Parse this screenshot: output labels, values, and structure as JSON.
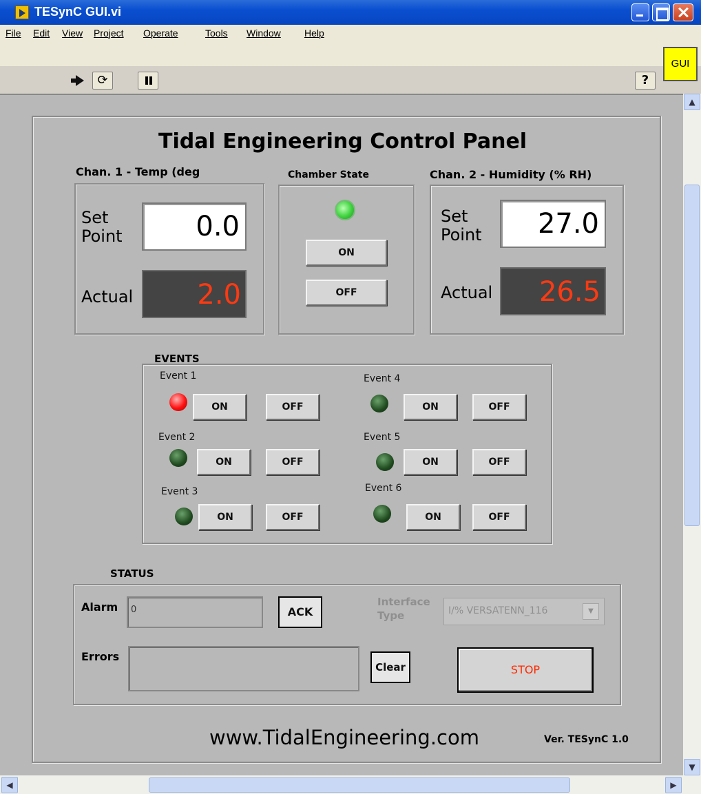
{
  "window": {
    "title": "TESynC GUI.vi"
  },
  "menu": [
    "File",
    "Edit",
    "View",
    "Project",
    "Operate",
    "Tools",
    "Window",
    "Help"
  ],
  "toolbar": {
    "continuous_glyph": "⟳",
    "help_glyph": "?",
    "gui_badge": "GUI"
  },
  "panel": {
    "title": "Tidal Engineering Control Panel",
    "ch1": {
      "label": "Chan. 1 - Temp (deg",
      "set_label": "Set Point",
      "set_value": "0.0",
      "actual_label": "Actual",
      "actual_value": "2.0"
    },
    "chamber": {
      "label": "Chamber State",
      "on_label": "ON",
      "off_label": "OFF",
      "led_state": "on"
    },
    "ch2": {
      "label": "Chan. 2 - Humidity (% RH)",
      "set_label": "Set Point",
      "set_value": "27.0",
      "actual_label": "Actual",
      "actual_value": "26.5"
    },
    "events": {
      "label": "EVENTS",
      "items": [
        {
          "name": "Event 1",
          "state": "on",
          "on_label": "ON",
          "off_label": "OFF"
        },
        {
          "name": "Event 2",
          "state": "off",
          "on_label": "ON",
          "off_label": "OFF"
        },
        {
          "name": "Event 3",
          "state": "off",
          "on_label": "ON",
          "off_label": "OFF"
        },
        {
          "name": "Event 4",
          "state": "off",
          "on_label": "ON",
          "off_label": "OFF"
        },
        {
          "name": "Event 5",
          "state": "off",
          "on_label": "ON",
          "off_label": "OFF"
        },
        {
          "name": "Event 6",
          "state": "off",
          "on_label": "ON",
          "off_label": "OFF"
        }
      ]
    },
    "status": {
      "label": "STATUS",
      "alarm_label": "Alarm",
      "alarm_value": "0",
      "ack_label": "ACK",
      "interface_label_1": "Interface",
      "interface_label_2": "Type",
      "interface_value": "I/% VERSATENN_116",
      "errors_label": "Errors",
      "errors_value": "",
      "clear_label": "Clear",
      "stop_label": "STOP"
    },
    "website": "www.TidalEngineering.com",
    "version": "Ver. TESynC 1.0"
  },
  "colors": {
    "actual_text": "#ff3a12",
    "stop_text": "#ff2a00",
    "led_green": "#3ed23e",
    "led_red": "#ff1010",
    "led_dark": "#1f4a1f",
    "gui_badge": "#ffff00"
  },
  "icons": [
    "app-icon",
    "minimize-icon",
    "maximize-icon",
    "close-icon",
    "run-arrow-icon",
    "run-continuous-icon",
    "pause-icon",
    "help-icon",
    "scroll-up-icon",
    "scroll-down-icon",
    "scroll-left-icon",
    "scroll-right-icon",
    "dropdown-arrow-icon"
  ]
}
